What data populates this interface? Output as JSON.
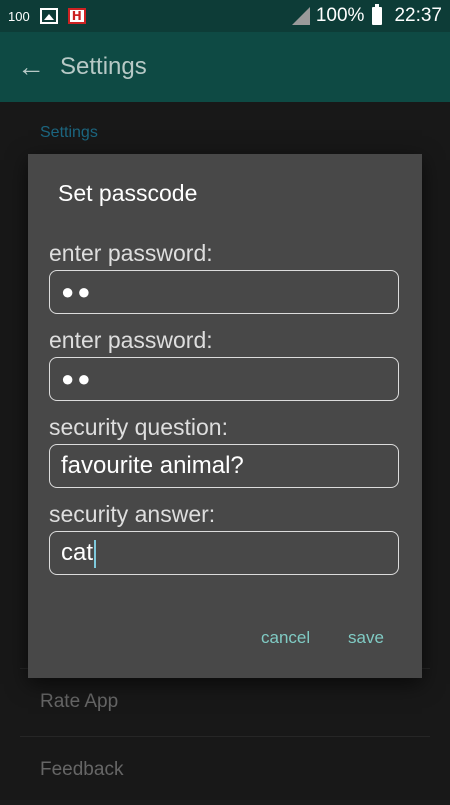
{
  "status_bar": {
    "left_number": "100",
    "battery_percent": "100%",
    "time": "22:37",
    "icons": [
      "image-icon",
      "hn-app-icon",
      "signal-icon",
      "battery-icon"
    ]
  },
  "app_bar": {
    "back_icon": "arrow-left-icon",
    "title": "Settings"
  },
  "settings": {
    "section_label": "Settings",
    "items": [
      {
        "label": "Rate App"
      },
      {
        "label": "Feedback"
      }
    ]
  },
  "dialog": {
    "title": "Set passcode",
    "fields": [
      {
        "label": "enter password:",
        "value": "●●",
        "type": "password"
      },
      {
        "label": "enter password:",
        "value": "●●",
        "type": "password"
      },
      {
        "label": "security question:",
        "value": "favourite animal?",
        "type": "text"
      },
      {
        "label": "security answer:",
        "value": "cat",
        "type": "text"
      }
    ],
    "cancel_label": "cancel",
    "save_label": "save"
  },
  "colors": {
    "status_bar": "#0d3c37",
    "app_bar": "#0e4a44",
    "dialog_bg": "#484848",
    "accent": "#80cbc4"
  }
}
